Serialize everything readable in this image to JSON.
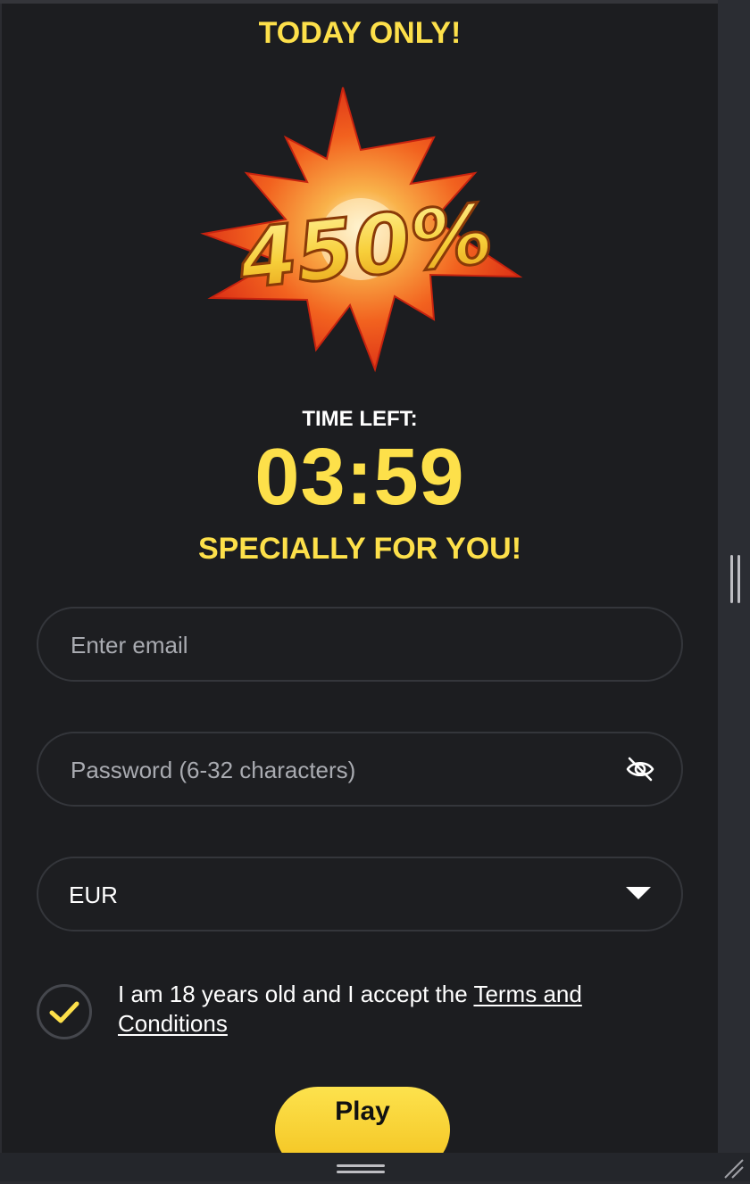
{
  "promo": {
    "headline": "TODAY ONLY!",
    "bonus_percent": "450%",
    "timer_label": "TIME LEFT:",
    "timer_value": "03:59",
    "subheadline": "SPECIALLY FOR YOU!"
  },
  "form": {
    "email_placeholder": "Enter email",
    "password_placeholder": "Password (6-32 characters)",
    "password_toggle_icon": "eye-slash-icon",
    "currency_value": "EUR",
    "currency_caret_icon": "chevron-down-icon",
    "consent_checked": true,
    "consent_text": "I am 18 years old and I accept the ",
    "consent_link": "Terms and Conditions",
    "submit_label": "Play"
  },
  "colors": {
    "accent_yellow": "#fde04a",
    "panel_background": "#1c1d20",
    "burst_red": "#e8381c",
    "burst_orange": "#f7892a"
  }
}
